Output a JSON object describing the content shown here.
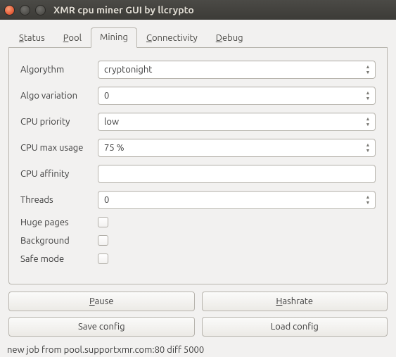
{
  "window": {
    "title": "XMR cpu miner GUI by llcrypto"
  },
  "tabs": {
    "status": {
      "pre": "S",
      "rest": "tatus"
    },
    "pool": {
      "pre": "P",
      "rest": "ool"
    },
    "mining": {
      "label": "Mining"
    },
    "connectivity": {
      "pre": "C",
      "rest": "onnectivity"
    },
    "debug": {
      "pre": "D",
      "rest": "ebug"
    }
  },
  "form": {
    "algorythm": {
      "label": "Algorythm",
      "value": "cryptonight"
    },
    "algovariation": {
      "label": "Algo variation",
      "value": "0"
    },
    "cpupriority": {
      "label": "CPU priority",
      "value": "low"
    },
    "cpumaxusage": {
      "label": "CPU max usage",
      "value": "75 %"
    },
    "cpuaffinity": {
      "label": "CPU affinity",
      "value": ""
    },
    "threads": {
      "label": "Threads",
      "value": "0"
    },
    "hugepages": {
      "label": "Huge pages"
    },
    "background": {
      "label": "Background"
    },
    "safemode": {
      "label": "Safe mode"
    }
  },
  "buttons": {
    "pause": {
      "pre": "P",
      "rest": "ause"
    },
    "hashrate": {
      "pre": "H",
      "rest": "ashrate"
    },
    "save": {
      "label": "Save config"
    },
    "load": {
      "label": "Load config"
    }
  },
  "status": {
    "text": "new job from pool.supportxmr.com:80 diff 5000"
  }
}
